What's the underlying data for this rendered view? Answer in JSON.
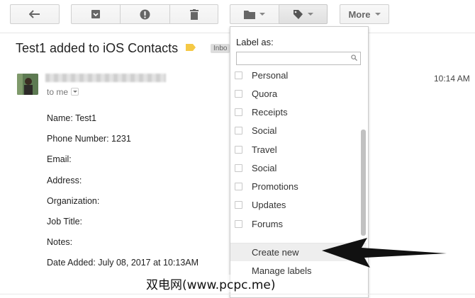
{
  "toolbar": {
    "back_icon": "reply-back-icon",
    "archive_icon": "archive-icon",
    "spam_icon": "report-spam-icon",
    "delete_icon": "trash-icon",
    "move_icon": "folder-icon",
    "labels_icon": "label-tag-icon",
    "more_label": "More"
  },
  "email": {
    "subject": "Test1 added to iOS Contacts",
    "inbox_badge": "Inbo",
    "to_me": "to me",
    "time": "10:14 AM",
    "body_lines": [
      "Name: Test1",
      "Phone Number: 1231",
      "Email:",
      "Address:",
      "Organization:",
      "Job Title:",
      "Notes:",
      "Date Added: July 08, 2017 at 10:13AM"
    ]
  },
  "label_menu": {
    "title": "Label as:",
    "search_value": "",
    "items": [
      {
        "label": "Personal",
        "checked": false
      },
      {
        "label": "Quora",
        "checked": false
      },
      {
        "label": "Receipts",
        "checked": false
      },
      {
        "label": "Social",
        "checked": false
      },
      {
        "label": "Travel",
        "checked": false
      },
      {
        "label": "Social",
        "checked": false
      },
      {
        "label": "Promotions",
        "checked": false
      },
      {
        "label": "Updates",
        "checked": false
      },
      {
        "label": "Forums",
        "checked": false
      }
    ],
    "create_new": "Create new",
    "manage_labels": "Manage labels"
  },
  "watermark": "双电网(www.pcpc.me)",
  "colors": {
    "label_tag": "#f5c945",
    "annotation_arrow": "#111111"
  }
}
